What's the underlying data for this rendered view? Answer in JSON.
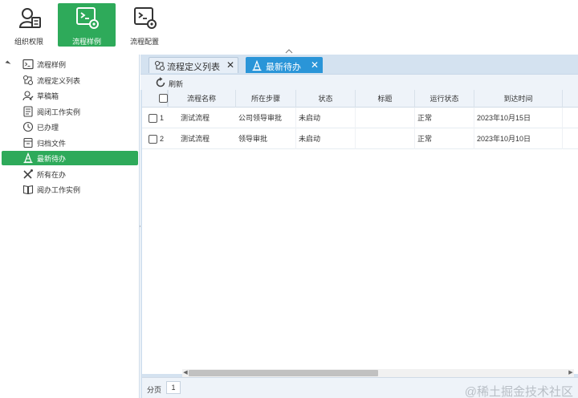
{
  "toolbar_top": {
    "items": [
      {
        "label": "组织权限",
        "icon": "user-card-icon"
      },
      {
        "label": "流程样例",
        "icon": "terminal-gear-icon"
      },
      {
        "label": "流程配置",
        "icon": "terminal-gear-icon"
      }
    ],
    "active_index": 1
  },
  "sidebar": {
    "root": {
      "label": "流程样例",
      "icon": "terminal-icon"
    },
    "items": [
      {
        "label": "流程定义列表",
        "icon": "process-icon"
      },
      {
        "label": "草稿箱",
        "icon": "user-edit-icon"
      },
      {
        "label": "阅闭工作实例",
        "icon": "document-icon"
      },
      {
        "label": "已办理",
        "icon": "clock-icon"
      },
      {
        "label": "归档文件",
        "icon": "archive-icon"
      },
      {
        "label": "最新待办",
        "icon": "cone-icon"
      },
      {
        "label": "所有在办",
        "icon": "tools-icon"
      },
      {
        "label": "阅办工作实例",
        "icon": "book-icon"
      }
    ],
    "selected_index": 5
  },
  "tabs": [
    {
      "label": "流程定义列表",
      "icon": "process-icon",
      "close": "✕"
    },
    {
      "label": "最新待办",
      "icon": "cone-icon",
      "close": "✕"
    }
  ],
  "active_tab": 1,
  "refresh_label": "刷新",
  "table": {
    "columns": [
      "流程名称",
      "所在步骤",
      "状态",
      "标题",
      "运行状态",
      "到达时间"
    ],
    "rows": [
      {
        "num": "1",
        "name": "测试流程",
        "step": "公司领导审批",
        "status": "未启动",
        "title": "",
        "run": "正常",
        "time": "2023年10月15日"
      },
      {
        "num": "2",
        "name": "测试流程",
        "step": "领导审批",
        "status": "未启动",
        "title": "",
        "run": "正常",
        "time": "2023年10月10日"
      }
    ]
  },
  "pager": {
    "label": "分页",
    "page": "1"
  },
  "watermark": "@稀土掘金技术社区",
  "colors": {
    "accent_green": "#2eaa5a",
    "tab_blue": "#2a95d8",
    "panel_bg": "#d4e2f0"
  }
}
